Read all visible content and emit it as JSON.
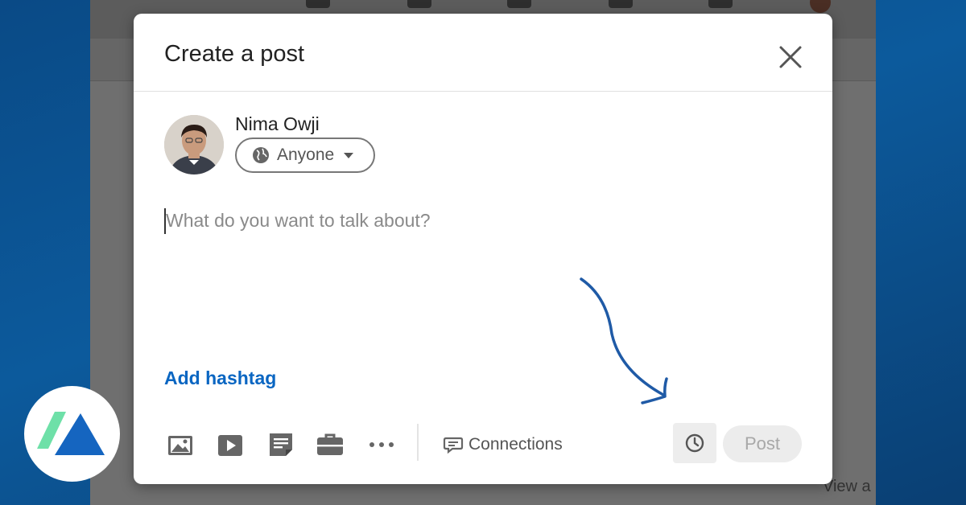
{
  "modal": {
    "title": "Create a post",
    "author_name": "Nima Owji",
    "visibility_label": "Anyone",
    "editor_placeholder": "What do you want to talk about?",
    "add_hashtag_label": "Add hashtag",
    "audience_label": "Connections",
    "post_label": "Post"
  },
  "background": {
    "right_text": "View a"
  },
  "colors": {
    "accent_link": "#0a66c2",
    "annotation_arrow": "#1f5aa6",
    "brand_dark": "#1565c0",
    "brand_light": "#6ee0a8"
  },
  "icons": [
    "close-icon",
    "globe-icon",
    "caret-down-icon",
    "photo-icon",
    "video-icon",
    "document-icon",
    "briefcase-icon",
    "more-icon",
    "comment-icon",
    "clock-icon"
  ]
}
